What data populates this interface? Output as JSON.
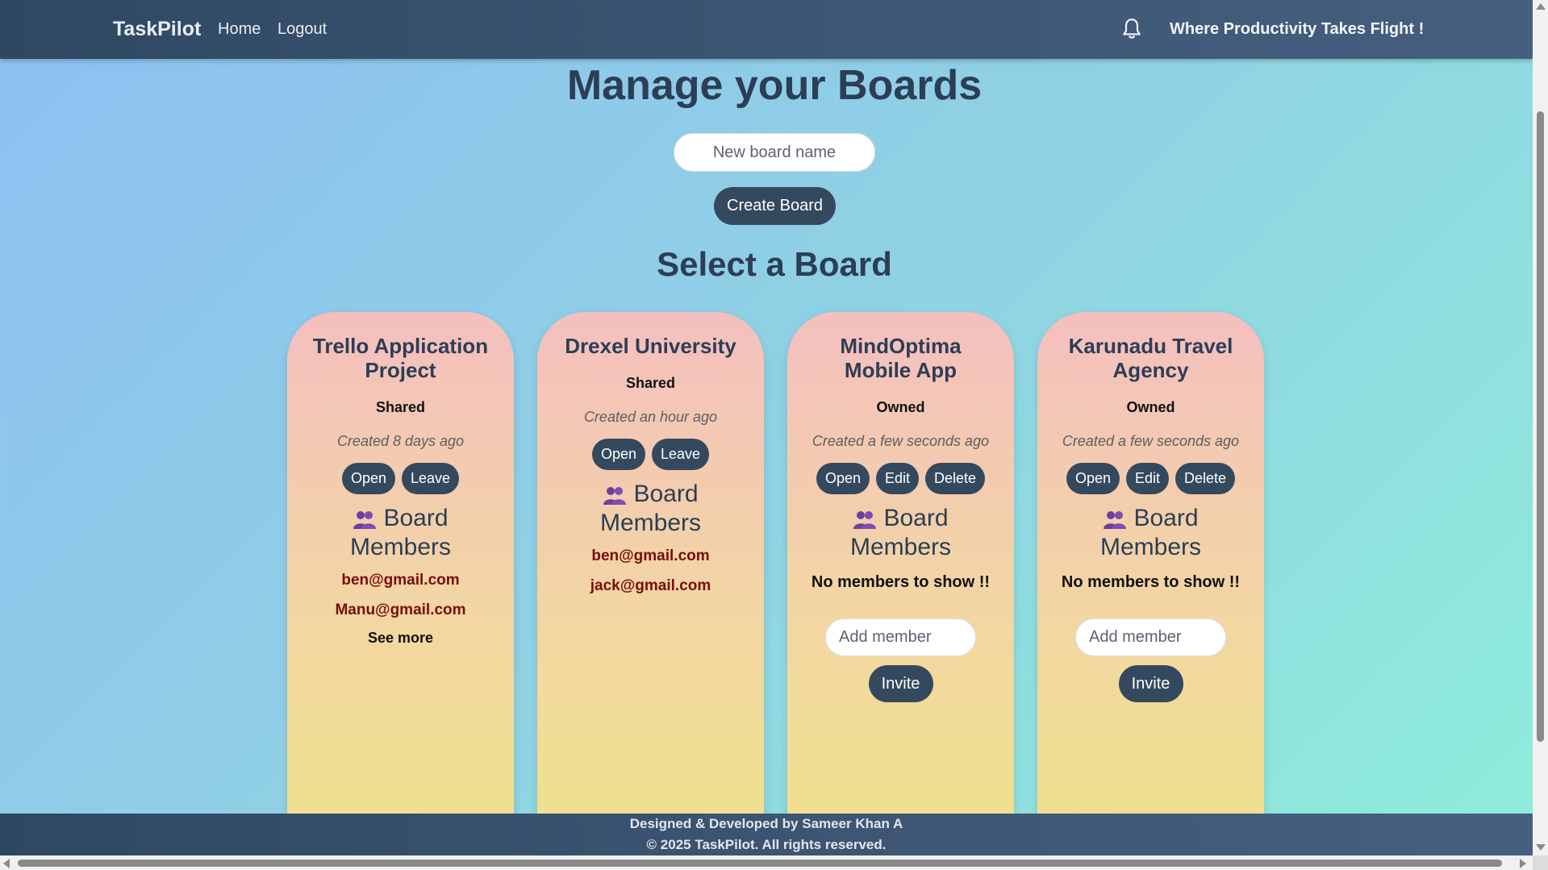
{
  "navbar": {
    "brand": "TaskPilot",
    "links": [
      "Home",
      "Logout"
    ],
    "tagline": "Where Productivity Takes Flight !",
    "icons": {
      "notifications": "bell-icon"
    }
  },
  "main": {
    "title": "Manage your Boards",
    "new_board_placeholder": "New board name",
    "create_label": "Create Board",
    "select_title": "Select a Board"
  },
  "members_label": "Board Members",
  "boards": [
    {
      "title": "Trello Application Project",
      "status": "Shared",
      "created": "Created 8 days ago",
      "actions": [
        "Open",
        "Leave"
      ],
      "members": [
        "ben@gmail.com",
        "Manu@gmail.com"
      ],
      "see_more": "See more"
    },
    {
      "title": "Drexel University",
      "status": "Shared",
      "created": "Created an hour ago",
      "actions": [
        "Open",
        "Leave"
      ],
      "members": [
        "ben@gmail.com",
        "jack@gmail.com"
      ]
    },
    {
      "title": "MindOptima Mobile App",
      "status": "Owned",
      "created": "Created a few seconds ago",
      "actions": [
        "Open",
        "Edit",
        "Delete"
      ],
      "no_members": "No members to show !!",
      "add_member_placeholder": "Add member",
      "invite_label": "Invite"
    },
    {
      "title": "Karunadu Travel Agency",
      "status": "Owned",
      "created": "Created a few seconds ago",
      "actions": [
        "Open",
        "Edit",
        "Delete"
      ],
      "no_members": "No members to show !!",
      "add_member_placeholder": "Add member",
      "invite_label": "Invite"
    }
  ],
  "footer": {
    "line1": "Designed & Developed by Sameer Khan A",
    "line2": "© 2025 TaskPilot. All rights reserved."
  },
  "colors": {
    "nav_bg": "#34495e",
    "button_bg": "#34495e",
    "member_email": "#7a0d0d",
    "card_top": "#f4bfbf",
    "card_bottom": "#f0e08d"
  }
}
